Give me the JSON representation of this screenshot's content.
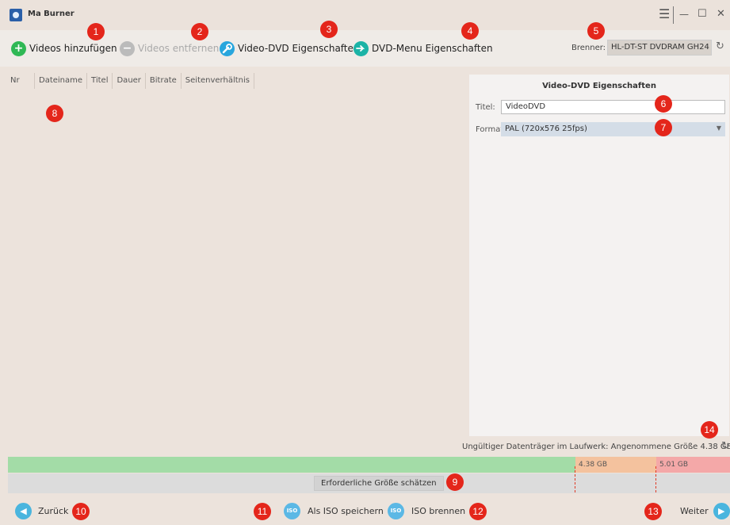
{
  "window": {
    "title": "Ma Burner",
    "controls": {
      "menu": "☰",
      "minimize": "—",
      "maximize": "☐",
      "close": "✕"
    }
  },
  "toolbar": {
    "add_videos": "Videos hinzufügen",
    "remove_videos": "Videos entfernen",
    "dvd_properties": "Video-DVD Eigenschaften",
    "menu_properties": "DVD-Menu Eigenschaften",
    "burner_label": "Brenner:",
    "burner_value": "HL-DT-ST DVDRAM GH24 ▾",
    "refresh": "↻"
  },
  "file_list": {
    "columns": [
      "Nr",
      "Dateiname",
      "Titel",
      "Dauer",
      "Bitrate",
      "Seitenverhältnis"
    ],
    "rows": []
  },
  "properties": {
    "header": "Video-DVD Eigenschaften",
    "title_label": "Titel:",
    "title_value": "VideoDVD",
    "format_label": "Format:",
    "format_value": "PAL (720x576 25fps)",
    "dropdown_arrow": "▼"
  },
  "disk": {
    "status": "Ungültiger Datenträger im Laufwerk: Angenommene Größe 4.38 GB",
    "refresh": "↻",
    "capacity_labels": [
      "4.38 GB",
      "5.01 GB"
    ],
    "estimate_button": "Erforderliche Größe schätzen"
  },
  "bottom": {
    "back": "Zurück",
    "save_iso": "Als ISO speichern",
    "burn_iso": "ISO brennen",
    "next": "Weiter",
    "iso_icon": "ISO",
    "back_arrow": "◀",
    "next_arrow": "▶"
  },
  "markers": [
    "1",
    "2",
    "3",
    "4",
    "5",
    "6",
    "7",
    "8",
    "9",
    "10",
    "11",
    "12",
    "13",
    "14"
  ],
  "colors": {
    "accent_marker": "#e4261b",
    "size_ok": "#a3dca7",
    "size_warn": "#f4c29e",
    "size_over": "#f4a8a8"
  }
}
